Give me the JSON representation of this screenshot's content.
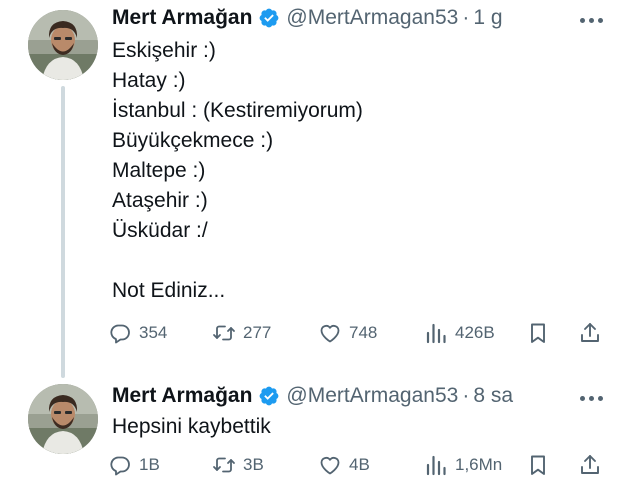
{
  "tweets": [
    {
      "author": {
        "name": "Mert Armağan",
        "handle": "@MertArmagan53",
        "verified": true
      },
      "time": "1 g",
      "text_lines": [
        "Eskişehir :)",
        "Hatay :)",
        "İstanbul : (Kestiremiyorum)",
        "Büyükçekmece :)",
        "Maltepe :)",
        "Ataşehir :)",
        "Üsküdar :/",
        "",
        "Not Ediniz..."
      ],
      "stats": {
        "replies": "354",
        "retweets": "277",
        "likes": "748",
        "views": "426B"
      }
    },
    {
      "author": {
        "name": "Mert Armağan",
        "handle": "@MertArmagan53",
        "verified": true
      },
      "time": "8 sa",
      "text_lines": [
        "Hepsini kaybettik"
      ],
      "stats": {
        "replies": "1B",
        "retweets": "3B",
        "likes": "4B",
        "views": "1,6Mn"
      }
    }
  ],
  "separator": "·",
  "icons": {
    "verified": "verified-badge-icon",
    "more": "more-dots-icon",
    "reply": "reply-icon",
    "retweet": "retweet-icon",
    "like": "heart-icon",
    "views": "views-icon",
    "bookmark": "bookmark-icon",
    "share": "share-icon"
  },
  "colors": {
    "text": "#0f1419",
    "secondary": "#536471",
    "verified": "#1d9bf0",
    "thread_line": "#cfd9de"
  }
}
